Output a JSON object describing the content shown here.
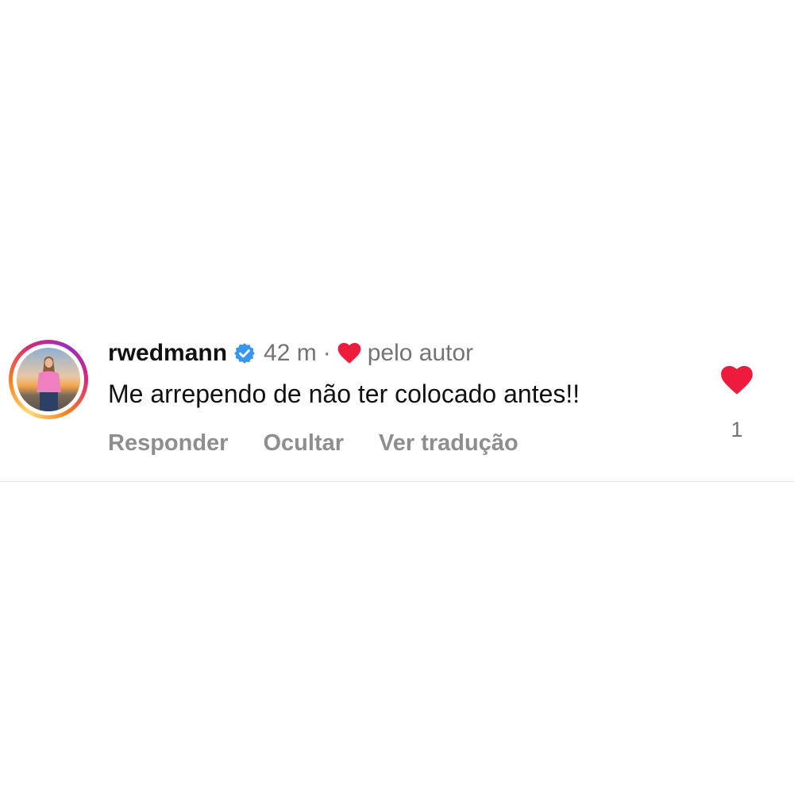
{
  "comment": {
    "username": "rwedmann",
    "verified_icon": "verified-badge-icon",
    "timestamp": "42 m",
    "separator": "·",
    "liked_by_author_icon": "heart-icon",
    "liked_by_author_label": "pelo autor",
    "text": "Me arrependo de não ter colocado antes!!",
    "actions": {
      "reply": "Responder",
      "hide": "Ocultar",
      "translate": "Ver tradução"
    },
    "like": {
      "icon": "heart-icon",
      "count": "1"
    }
  },
  "colors": {
    "heart": "#ed1c3c",
    "verified": "#3797f0",
    "secondary_text": "#737373",
    "action_text": "#8e8e8e"
  }
}
